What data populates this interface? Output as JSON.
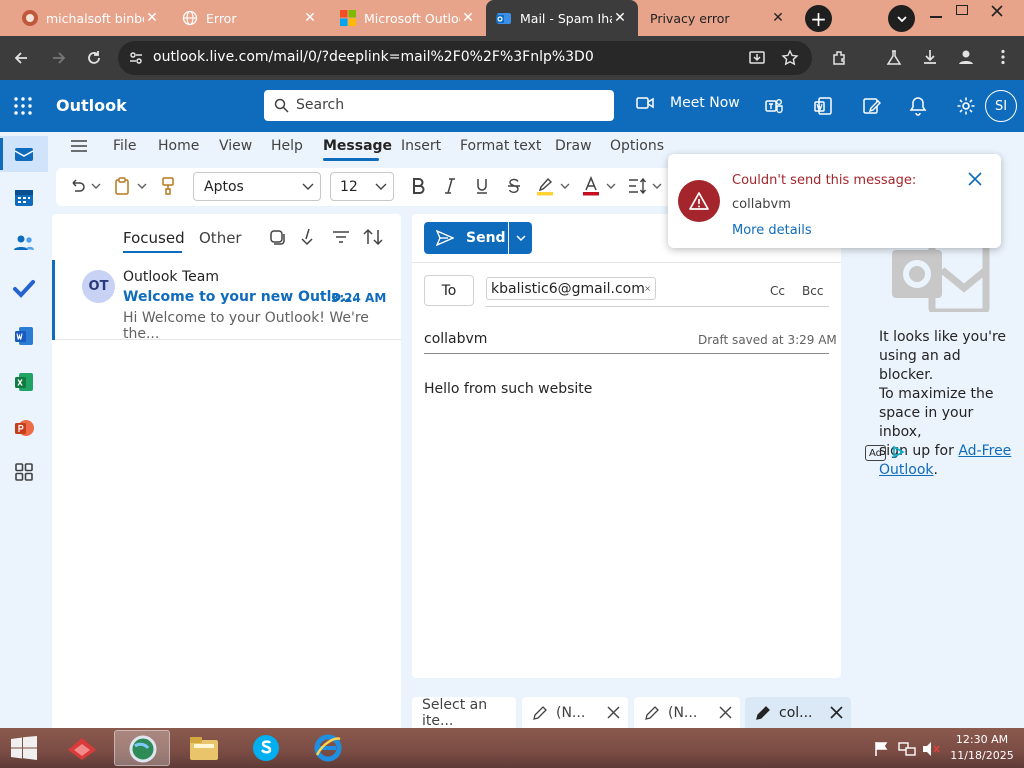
{
  "browser": {
    "tabs": [
      {
        "title": "michalsoft binbows",
        "icon": "michalsoft-icon"
      },
      {
        "title": "Error",
        "icon": "globe-icon"
      },
      {
        "title": "Microsoft Outlook",
        "icon": "microsoft-logo-icon"
      },
      {
        "title": "Mail - Spam Ihak",
        "icon": "outlook-icon"
      },
      {
        "title": "Privacy error",
        "icon": ""
      }
    ],
    "new_tab": "+",
    "close": "✕",
    "url": "outlook.live.com/mail/0/?deeplink=mail%2F0%2F%3Fnlp%3D0"
  },
  "outlook": {
    "app_name": "Outlook",
    "search_placeholder": "Search",
    "meet_now": "Meet Now",
    "avatar_initials": "SI",
    "accent": "#0f6cbd"
  },
  "ribbon": {
    "tabs": [
      "File",
      "Home",
      "View",
      "Help",
      "Message",
      "Insert",
      "Format text",
      "Draw",
      "Options"
    ],
    "active_tab": "Message",
    "font_name": "Aptos",
    "font_size": "12"
  },
  "message_list": {
    "tab_focused": "Focused",
    "tab_other": "Other",
    "item": {
      "avatar": "OT",
      "sender": "Outlook Team",
      "subject": "Welcome to your new Outlo...",
      "time": "3:24 AM",
      "preview": "Hi Welcome to your Outlook! We're the..."
    }
  },
  "compose": {
    "send_label": "Send",
    "to_label": "To",
    "recipient": "kbalistic6@gmail.com",
    "cc": "Cc",
    "bcc": "Bcc",
    "subject": "collabvm",
    "draft_status": "Draft saved at 3:29 AM",
    "body": "Hello from such website"
  },
  "toast": {
    "title": "Couldn't send this message:",
    "subject": "collabvm",
    "link": "More details",
    "accent": "#a4262c"
  },
  "ad": {
    "line1": "It looks like you're",
    "line2": "using an ad blocker.",
    "line3": "To maximize the",
    "line4": "space in your inbox,",
    "line5": "sign up for",
    "link1": "Ad-Free",
    "link2": "Outlook",
    "period": ".",
    "badge": "Ad"
  },
  "drafts_bar": [
    {
      "label": "Select an ite..."
    },
    {
      "label": "(N..."
    },
    {
      "label": "(N..."
    },
    {
      "label": "col..."
    }
  ],
  "taskbar": {
    "time": "12:30 AM",
    "date": "11/18/2025"
  }
}
